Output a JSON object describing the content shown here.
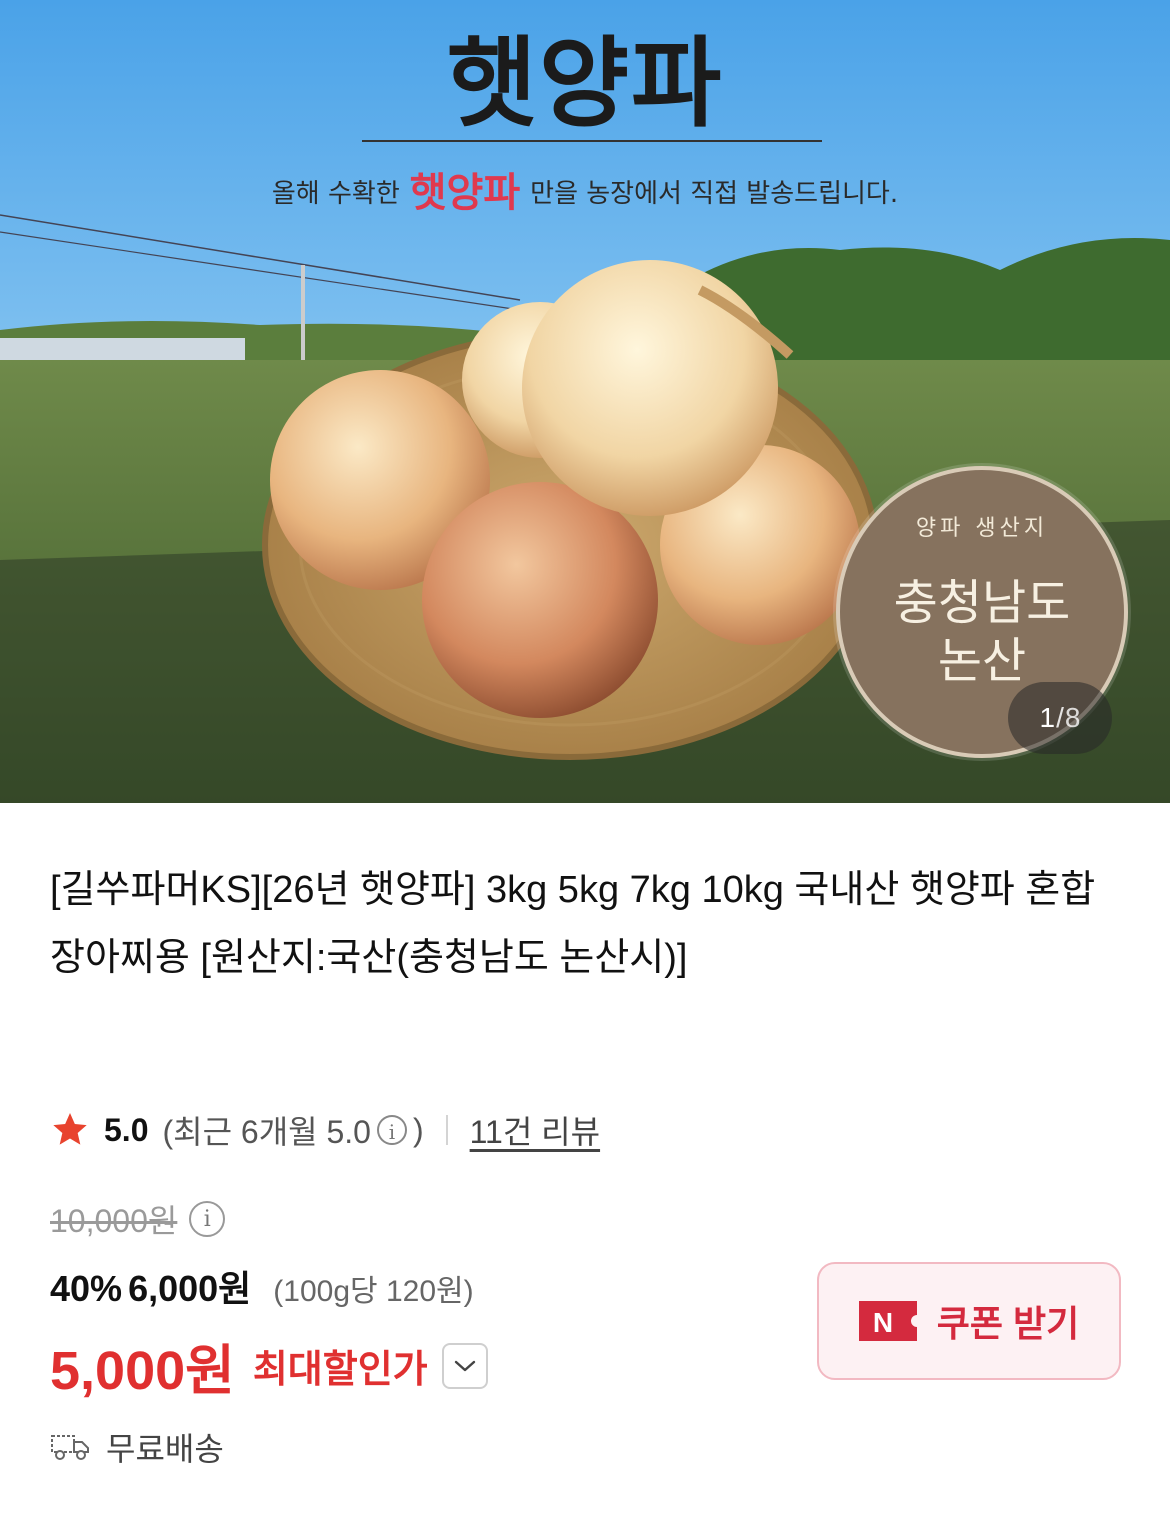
{
  "hero": {
    "title": "햇양파",
    "subtitle_before": "올해 수확한",
    "subtitle_highlight": "햇양파",
    "subtitle_after": "만을 농장에서 직접 발송드립니다.",
    "badge_subtitle": "양파 생산지",
    "badge_line1": "충청남도",
    "badge_line2": "논산",
    "counter_current": "1",
    "counter_separator": "/",
    "counter_total": "8"
  },
  "product": {
    "title": "[길쑤파머KS][26년 햇양파] 3kg 5kg 7kg 10kg 국내산 햇양파 혼합 장아찌용 [원산지:국산(충청남도 논산시)]"
  },
  "rating": {
    "score": "5.0",
    "recent_label": "(최근 6개월 5.0",
    "recent_close": ")",
    "reviews": "11건 리뷰"
  },
  "price": {
    "original": "10,000원",
    "discount_rate": "40%",
    "sale_price": "6,000원",
    "unit_price": "(100g당 120원)",
    "max_discount_price": "5,000원",
    "max_discount_label": "최대할인가"
  },
  "coupon": {
    "label": "쿠폰 받기",
    "icon_letter": "N"
  },
  "shipping": {
    "label": "무료배송"
  },
  "colors": {
    "accent_red": "#e03030",
    "coupon_bg": "#fdf1f3",
    "coupon_border": "#f2b9c2",
    "star": "#e8432e"
  }
}
